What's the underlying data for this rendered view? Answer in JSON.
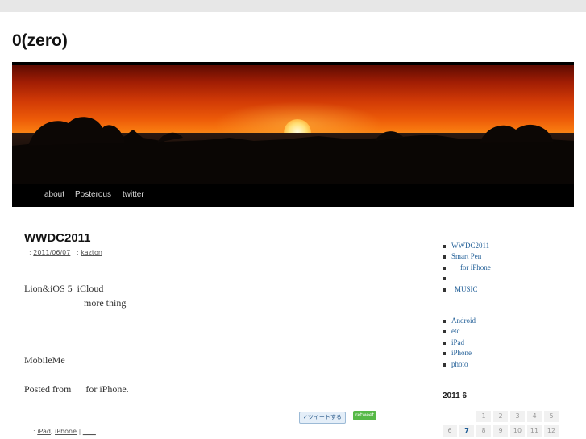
{
  "site": {
    "title": "0(zero)"
  },
  "nav": {
    "items": [
      "about",
      "Posterous",
      "twitter"
    ]
  },
  "post": {
    "title": "WWDC2011",
    "meta": {
      "date_prefix": ":",
      "date": "2011/06/07",
      "author_prefix": ":",
      "author": "kazton"
    },
    "paragraphs": [
      "Lion&iOS 5  iCloud",
      "more thing",
      "MobileMe",
      "Posted from      for iPhone."
    ],
    "share": {
      "tweet_label": "ツイートする",
      "retweet_label": "retweet"
    },
    "footer": {
      "prefix": ":",
      "tag1": "iPad",
      "sep": ",",
      "tag2": "iPhone",
      "pipe": "|",
      "comments": "____"
    }
  },
  "sidebar": {
    "recent_posts": [
      "WWDC2011",
      "Smart Pen",
      "for iPhone",
      "",
      "MUSIC"
    ],
    "categories": [
      "Android",
      "etc",
      "iPad",
      "iPhone",
      "photo"
    ],
    "calendar": {
      "title": "2011  6",
      "week1": [
        "",
        "",
        "1",
        "2",
        "3",
        "4",
        "5"
      ],
      "week2": [
        "6",
        "7",
        "8",
        "9",
        "10",
        "11",
        "12"
      ],
      "today": "7"
    }
  },
  "colors": {
    "link": "#1f5d96",
    "nav_bg": "#000000",
    "page_bg": "#ffffff",
    "outer_bg": "#e7e7e7"
  }
}
